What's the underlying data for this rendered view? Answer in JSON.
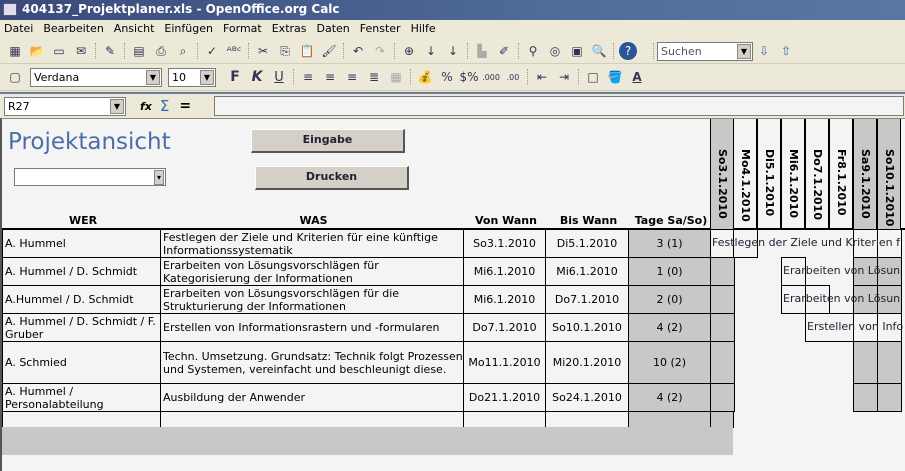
{
  "window": {
    "title": "404137_Projektplaner.xls - OpenOffice.org Calc"
  },
  "menu": [
    "Datei",
    "Bearbeiten",
    "Ansicht",
    "Einfügen",
    "Format",
    "Extras",
    "Daten",
    "Fenster",
    "Hilfe"
  ],
  "toolbar": {
    "search_placeholder": "Suchen",
    "font_name": "Verdana",
    "font_size": "10",
    "bold": "F",
    "italic": "K",
    "underline": "U"
  },
  "formula_bar": {
    "cell_ref": "R27",
    "fx": "fx",
    "sum": "Σ",
    "equals": "=",
    "value": ""
  },
  "sheet": {
    "title": "Projektansicht",
    "title_color": "#4a6fa5",
    "buttons": {
      "input": "Eingabe",
      "print": "Drucken"
    },
    "headers": {
      "who": "WER",
      "what": "WAS",
      "from": "Von Wann",
      "to": "Bis Wann",
      "days": "Tage Sa/So)"
    },
    "dates": [
      "So3.1.2010",
      "Mo4.1.2010",
      "Di5.1.2010",
      "Mi6.1.2010",
      "Do7.1.2010",
      "Fr8.1.2010",
      "Sa9.1.2010",
      "So10.1.2010"
    ],
    "rows": [
      {
        "who": "A. Hummel",
        "what": "Festlegen der Ziele und Kriterien für eine künftige Informationssystematik",
        "from": "So3.1.2010",
        "to": "Di5.1.2010",
        "days": "3 (1)",
        "bar": "Festlegen der Ziele und Kriterien f"
      },
      {
        "who": "A. Hummel / D. Schmidt",
        "what": "Erarbeiten von Lösungsvorschlägen für Kategorisierung der Informationen",
        "from": "Mi6.1.2010",
        "to": "Mi6.1.2010",
        "days": "1 (0)",
        "bar": "Erarbeiten von Lösun"
      },
      {
        "who": "A.Hummel / D. Schmidt",
        "what": "Erarbeiten von Lösungsvorschlägen für die Strukturierung der Informationen",
        "from": "Mi6.1.2010",
        "to": "Do7.1.2010",
        "days": "2 (0)",
        "bar": "Erarbeiten von Lösun"
      },
      {
        "who": "A. Hummel / D. Schmidt / F. Gruber",
        "what": "Erstellen von Informationsrastern und -formularen",
        "from": "Do7.1.2010",
        "to": "So10.1.2010",
        "days": "4 (2)",
        "bar": "Erstellen von Info"
      },
      {
        "who": "A. Schmied",
        "what": "Techn. Umsetzung. Grundsatz: Technik folgt Prozessen und Systemen, vereinfacht und beschleunigt diese.",
        "from": "Mo11.1.2010",
        "to": "Mi20.1.2010",
        "days": "10 (2)"
      },
      {
        "who": "A. Hummel / Personalabteilung",
        "what": "Ausbildung der Anwender",
        "from": "Do21.1.2010",
        "to": "So24.1.2010",
        "days": "4 (2)"
      }
    ]
  }
}
